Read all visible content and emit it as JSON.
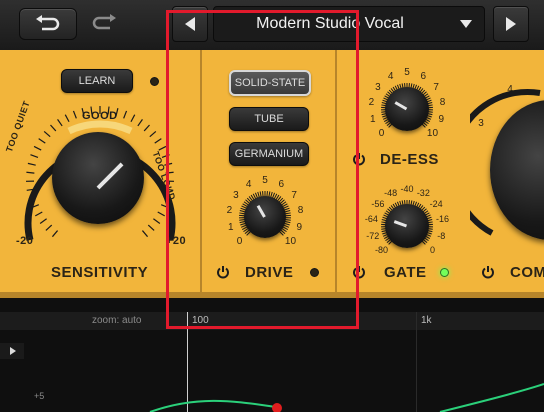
{
  "toolbar": {
    "undo_icon": "undo-icon",
    "redo_icon": "redo-icon"
  },
  "preset": {
    "name": "Modern Studio Vocal",
    "prev_icon": "triangle-left-icon",
    "dropdown_icon": "triangle-down-icon",
    "next_icon": "triangle-right-icon"
  },
  "sensitivity": {
    "learn_label": "LEARN",
    "good_label": "GOOD",
    "too_quiet_label": "TOO QUIET",
    "too_loud_label": "TOO LOUD",
    "min_label": "-20",
    "max_label": "+20",
    "title": "SENSITIVITY"
  },
  "saturation": {
    "modes": [
      "SOLID-STATE",
      "TUBE",
      "GERMANIUM"
    ],
    "selected": "SOLID-STATE",
    "drive_title": "DRIVE",
    "drive_scale": [
      "0",
      "1",
      "2",
      "3",
      "4",
      "5",
      "6",
      "7",
      "8",
      "9",
      "10"
    ]
  },
  "deess": {
    "title": "DE-ESS",
    "scale": [
      "0",
      "1",
      "2",
      "3",
      "4",
      "5",
      "6",
      "7",
      "8",
      "9",
      "10"
    ]
  },
  "gate": {
    "title": "GATE",
    "scale": [
      "-80",
      "-72",
      "-64",
      "-56",
      "-48",
      "-40",
      "-32",
      "-24",
      "-16",
      "-8",
      "0"
    ]
  },
  "compressor": {
    "title": "COM",
    "scale": [
      "3",
      "4"
    ]
  },
  "analyzer": {
    "zoom_label": "zoom: auto",
    "freq_100": "100",
    "freq_1k": "1k",
    "db_plus5": "+5"
  },
  "colors": {
    "panel": "#f2b53b",
    "highlight": "#e21a2c",
    "gate_led": "#73ff5a"
  }
}
